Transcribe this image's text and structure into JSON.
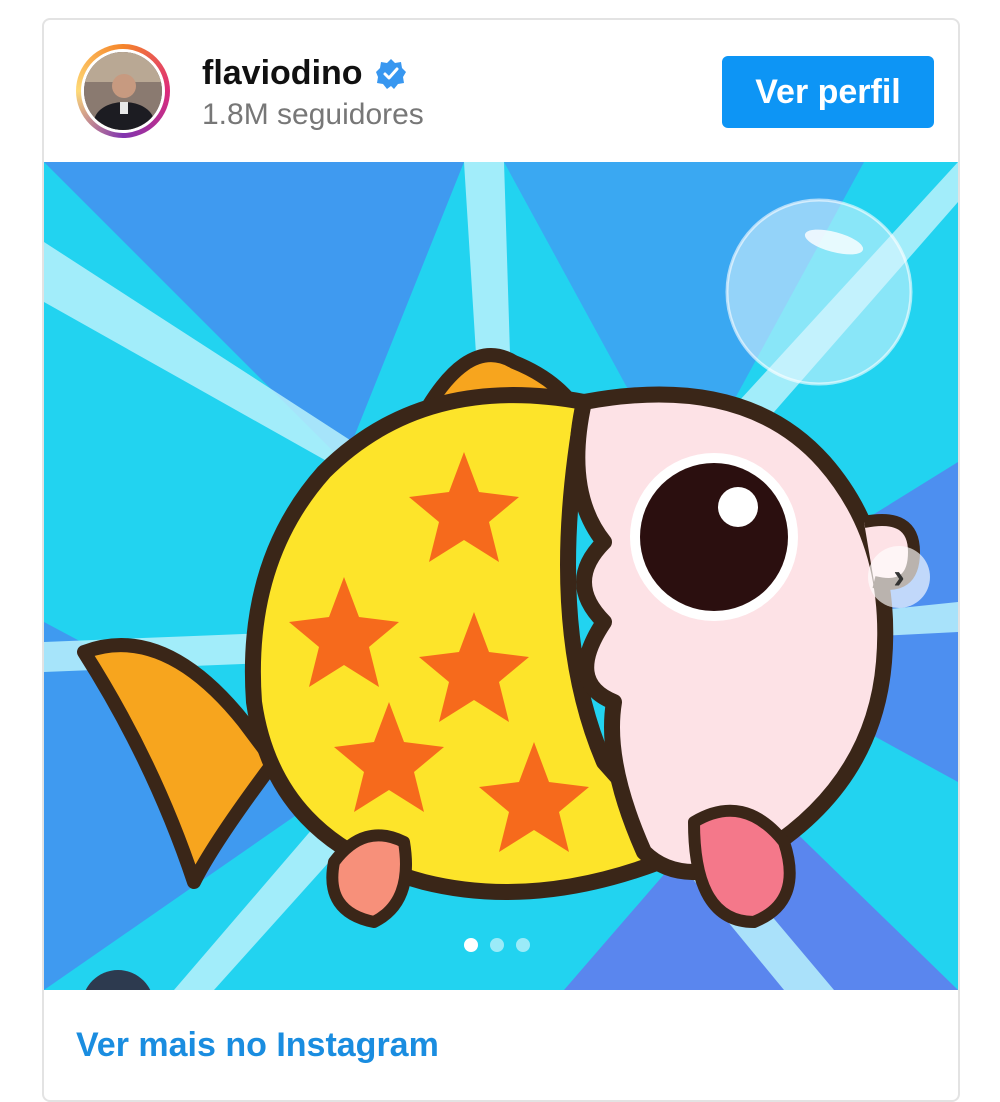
{
  "header": {
    "username": "flaviodino",
    "verified_icon": "verified-badge-icon",
    "followers_count": "1.8M",
    "followers_label": "seguidores",
    "profile_button_label": "Ver perfil"
  },
  "media": {
    "image_icon": "cartoon-fish-illustration",
    "next_icon": "chevron-right-icon",
    "carousel_total": 3,
    "carousel_active": 1
  },
  "footer": {
    "link_label": "Ver mais no Instagram"
  },
  "colors": {
    "accent": "#0d95f5",
    "link": "#1a8de0",
    "background_blue": "#3f9af0",
    "background_cyan": "#22d3f0"
  }
}
